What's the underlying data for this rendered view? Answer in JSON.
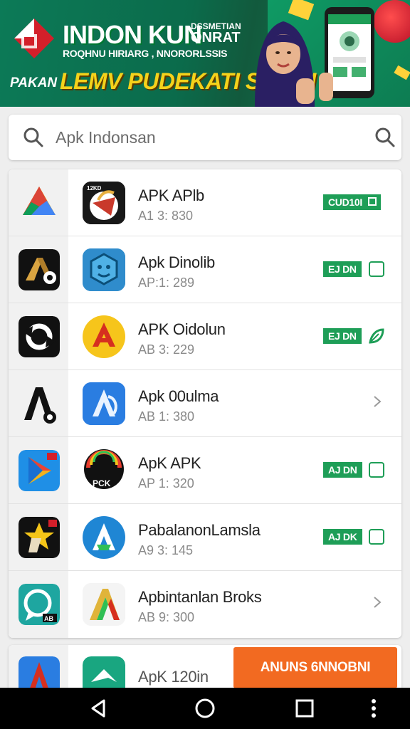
{
  "banner": {
    "title": "INDON KUN",
    "title_small_top": "DSSMETIAN",
    "title_small_bottom": "ONRAT",
    "subtitle": "ROQHNU HIRIARG , NNORORLSSIS",
    "left_text": "PAKAN",
    "headline": "LEMV PUDEKATI SOBDI"
  },
  "search": {
    "placeholder": "Apk Indonsan"
  },
  "apps": [
    {
      "name": "APK APlb",
      "meta": "A1 3: 830",
      "action": "badge",
      "badge": "CUD10I"
    },
    {
      "name": "Apk Dinolib",
      "meta": "AP:1: 289",
      "action": "badge",
      "badge": "EJ DN"
    },
    {
      "name": "APK Oidolun",
      "meta": "AB 3: 229",
      "action": "badge",
      "badge": "EJ DN"
    },
    {
      "name": "Apk 00ulma",
      "meta": "AB 1: 380",
      "action": "chevron",
      "badge": ""
    },
    {
      "name": "ApK APK",
      "meta": "AP 1: 320",
      "action": "badge",
      "badge": "AJ DN"
    },
    {
      "name": "PabalanonLamsla",
      "meta": "A9 3: 145",
      "action": "badge",
      "badge": "AJ DK"
    },
    {
      "name": "Apbintanlan Broks",
      "meta": "AB 9: 300",
      "action": "chevron",
      "badge": ""
    }
  ],
  "app_icon_labels": {
    "row1": "12KD",
    "row5": "PCK",
    "side7": "AB"
  },
  "bottom_row": {
    "name": "ApK 120in",
    "cta": "ANUNS 6NNOBNI"
  },
  "colors": {
    "accent_green": "#1e9e57",
    "cta_orange": "#f26a21",
    "banner_green": "#0c7a57",
    "headline_yellow": "#f5d21b"
  },
  "nav_icons": [
    "back-icon",
    "home-icon",
    "recents-icon",
    "more-vert-icon"
  ]
}
